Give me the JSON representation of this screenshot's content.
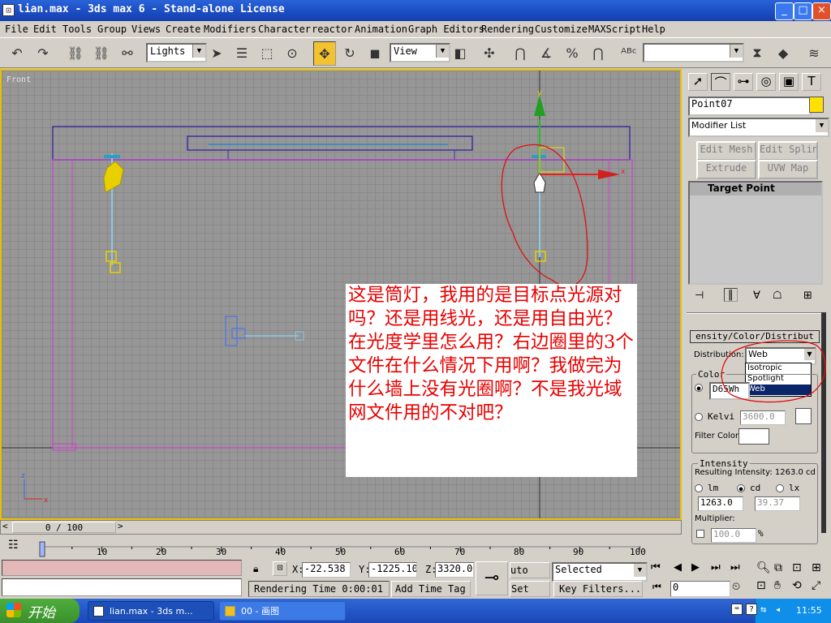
{
  "window": {
    "title": "lian.max - 3ds max 6 - Stand-alone License",
    "min": "_",
    "max": "□",
    "close": "×"
  },
  "menu": [
    "File",
    "Edit",
    "Tools",
    "Group",
    "Views",
    "Create",
    "Modifiers",
    "Character",
    "reactor",
    "Animation",
    "Graph Editors",
    "Rendering",
    "Customize",
    "MAXScript",
    "Help"
  ],
  "toolbar": {
    "selection_filter": "Lights",
    "ref_coord": "View",
    "named_selection": ""
  },
  "viewport": {
    "label": "Front",
    "axis_x": "x",
    "axis_y": "y",
    "axis_z": "z"
  },
  "note": {
    "text": "这是筒灯，我用的是目标点光源对吗？还是用线光，还是用自由光？在光度学里怎么用？右边圈里的3个文件在什么情况下用啊？我做完为什么墙上没有光圈啊？不是我光域网文件用的不对吧？"
  },
  "panel": {
    "object_name": "Point07",
    "object_color": "#ffe000",
    "modifier_list": "Modifier List",
    "buttons": [
      "Edit Mesh",
      "Edit Spline",
      "Extrude",
      "UVW Map"
    ],
    "stack_item": "Target Point",
    "rollout_title": "ensity/Color/Distribut",
    "distribution_label": "Distribution:",
    "distribution_value": "Web",
    "distribution_options": [
      "Isotropic",
      "Spotlight",
      "Web"
    ],
    "distribution_selected": "Web",
    "color_group": "Color",
    "color_preset": "D65Wh",
    "kelvin_label": "Kelvi",
    "kelvin_value": "3600.0",
    "filter_color_label": "Filter Color:",
    "intensity_group": "Intensity",
    "resulting_intensity": "Resulting Intensity: 1263.0 cd",
    "unit_lm": "lm",
    "unit_cd": "cd",
    "unit_lx": "lx",
    "intensity_value": "1263.0",
    "lx_value": "39.37",
    "multiplier_label": "Multiplier:",
    "multiplier_value": "100.0",
    "percent": "%"
  },
  "timeline": {
    "frame": "0 / 100",
    "ticks": [
      "0",
      "10",
      "20",
      "30",
      "40",
      "50",
      "60",
      "70",
      "80",
      "90",
      "100"
    ]
  },
  "status": {
    "x_label": "X:",
    "x_value": "-22.538",
    "y_label": "Y:",
    "y_value": "-1225.10",
    "z_label": "Z:",
    "z_value": "3320.0",
    "render_time": "Rendering Time  0:00:01",
    "add_time_tag": "Add Time Tag",
    "auto_key": "uto Key",
    "set_key": "Set Key",
    "key_mode": "Selected",
    "key_filters": "Key Filters...",
    "current_frame": "0"
  },
  "taskbar": {
    "start": "开始",
    "task1": "lian.max - 3ds m...",
    "task2": "00 - 画图",
    "clock": "11:55"
  }
}
